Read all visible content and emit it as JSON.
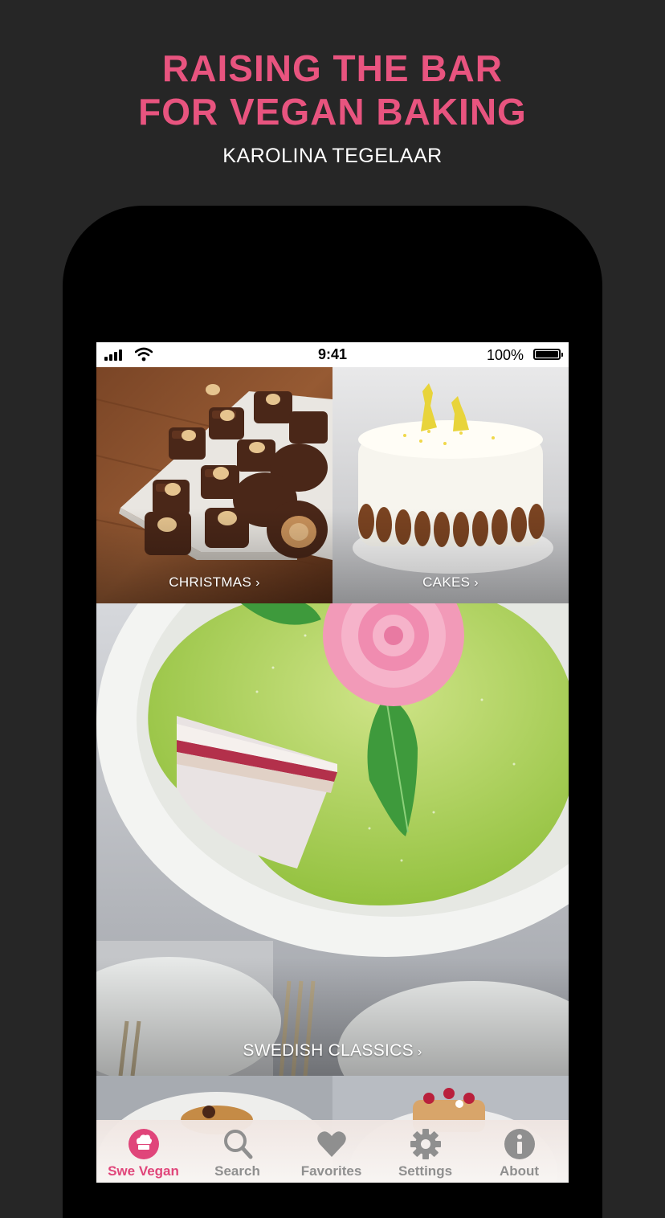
{
  "promo": {
    "title_line1": "RAISING THE BAR",
    "title_line2": "FOR VEGAN BAKING",
    "author": "KAROLINA TEGELAAR",
    "accent_color": "#e8547f"
  },
  "status_bar": {
    "time": "9:41",
    "battery_percent": "100%",
    "battery_level": 1.0
  },
  "categories": [
    {
      "label": "CHRISTMAS",
      "image": "chocolate-hazelnut-truffles",
      "chevron": "›"
    },
    {
      "label": "CAKES",
      "image": "white-frosted-pecan-cake",
      "chevron": "›"
    },
    {
      "label": "SWEDISH CLASSICS",
      "image": "green-princess-cake-with-pink-rose",
      "chevron": "›"
    }
  ],
  "tab_bar": {
    "active_color": "#e0457a",
    "inactive_color": "#8f8f8f",
    "tabs": [
      {
        "label": "Swe Vegan",
        "icon": "chef-hat-icon",
        "active": true
      },
      {
        "label": "Search",
        "icon": "search-icon",
        "active": false
      },
      {
        "label": "Favorites",
        "icon": "heart-icon",
        "active": false
      },
      {
        "label": "Settings",
        "icon": "gear-icon",
        "active": false
      },
      {
        "label": "About",
        "icon": "info-icon",
        "active": false
      }
    ]
  }
}
